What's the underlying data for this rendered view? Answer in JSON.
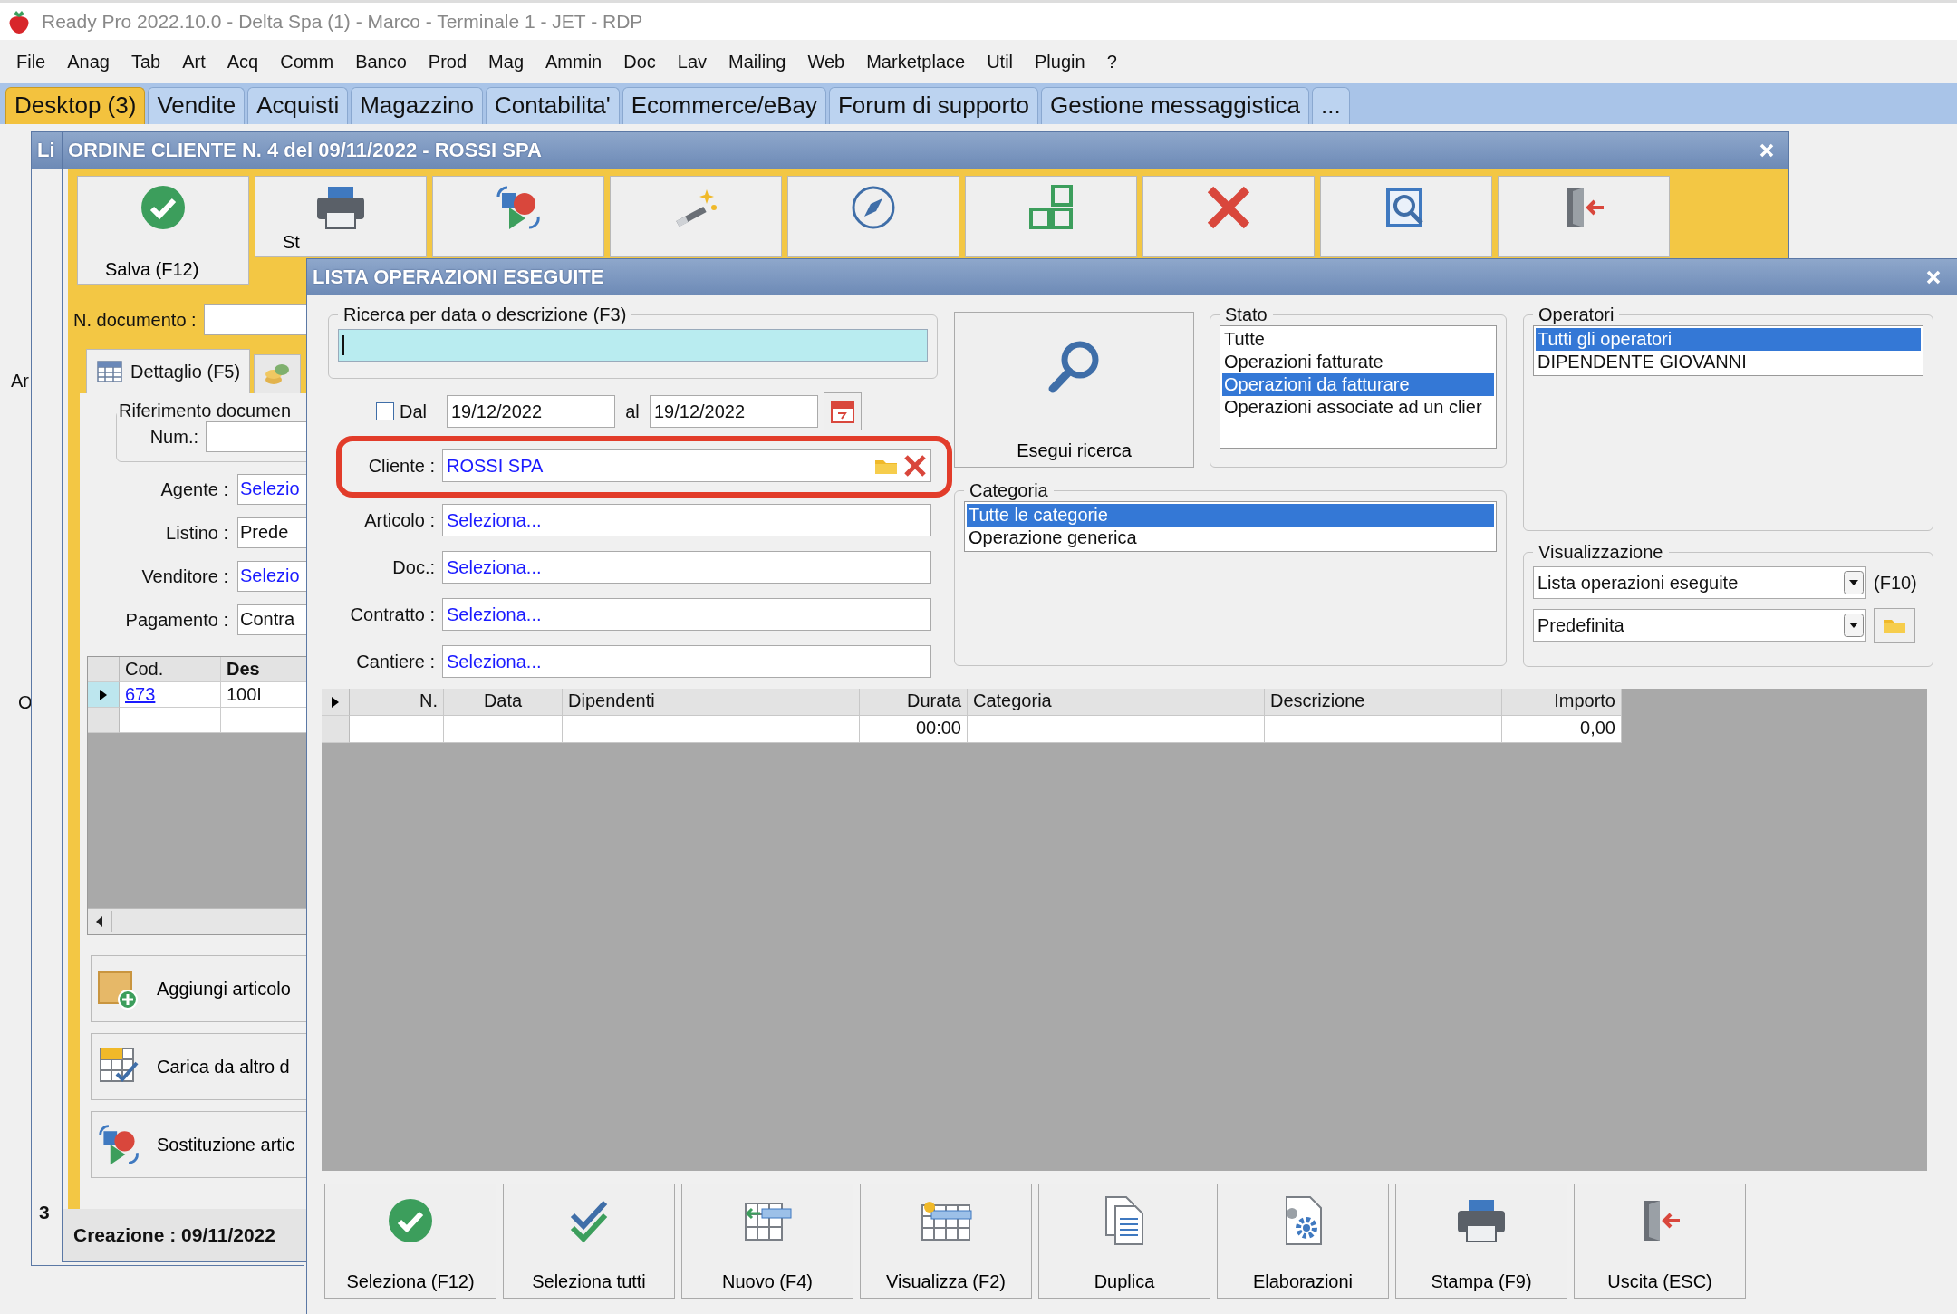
{
  "window": {
    "title": "Ready Pro 2022.10.0 - Delta Spa (1) - Marco - Terminale 1 - JET - RDP"
  },
  "menu": [
    "File",
    "Anag",
    "Tab",
    "Art",
    "Acq",
    "Comm",
    "Banco",
    "Prod",
    "Mag",
    "Ammin",
    "Doc",
    "Lav",
    "Mailing",
    "Web",
    "Marketplace",
    "Util",
    "Plugin",
    "?"
  ],
  "tabs": [
    {
      "label": "Desktop (3)",
      "selected": true
    },
    {
      "label": "Vendite",
      "selected": false
    },
    {
      "label": "Acquisti",
      "selected": false
    },
    {
      "label": "Magazzino",
      "selected": false
    },
    {
      "label": "Contabilita'",
      "selected": false
    },
    {
      "label": "Ecommerce/eBay",
      "selected": false
    },
    {
      "label": "Forum di supporto",
      "selected": false
    },
    {
      "label": "Gestione messaggistica",
      "selected": false
    },
    {
      "label": "...",
      "selected": false
    }
  ],
  "desktop_labels": [
    "Ar",
    "O"
  ],
  "back_window": {
    "title": "Li",
    "footer": "3"
  },
  "order_window": {
    "title": "ORDINE CLIENTE N. 4 del 09/11/2022 - ROSSI SPA",
    "toolbar_labels": [
      "Salva (F12)",
      "St"
    ],
    "document_label": "N. documento :",
    "tabs": [
      {
        "label": "Dettaglio (F5)",
        "selected": true
      },
      {
        "selected": false
      }
    ],
    "reference_group": "Riferimento documen",
    "num_label": "Num.:",
    "fields": [
      {
        "label": "Agente :",
        "value": "Selezio",
        "kind": "link"
      },
      {
        "label": "Listino :",
        "value": "Prede",
        "kind": "text"
      },
      {
        "label": "Venditore :",
        "value": "Selezio",
        "kind": "link"
      },
      {
        "label": "Pagamento :",
        "value": "Contra",
        "kind": "text"
      }
    ],
    "grid": {
      "columns": [
        "Cod.",
        "Des"
      ],
      "rows": [
        {
          "code": "673",
          "description": "100I"
        }
      ]
    },
    "actions": [
      "Aggiungi articolo",
      "Carica da altro d",
      "Sostituzione artic"
    ],
    "status": "Creazione : 09/11/2022"
  },
  "dialog": {
    "title": "LISTA OPERAZIONI ESEGUITE",
    "search": {
      "legend": "Ricerca per data o descrizione (F3)"
    },
    "date_filter": {
      "checked": false,
      "label": "Dal",
      "from": "19/12/2022",
      "to_label": "al",
      "to": "19/12/2022"
    },
    "fields": [
      {
        "label": "Cliente :",
        "value": "ROSSI SPA",
        "kind": "client"
      },
      {
        "label": "Articolo :",
        "value": "Seleziona...",
        "kind": "select"
      },
      {
        "label": "Doc.:",
        "value": "Seleziona...",
        "kind": "select"
      },
      {
        "label": "Contratto :",
        "value": "Seleziona...",
        "kind": "select"
      },
      {
        "label": "Cantiere :",
        "value": "Seleziona...",
        "kind": "select"
      }
    ],
    "search_button": "Esegui ricerca",
    "status": {
      "legend": "Stato",
      "items": [
        {
          "label": "Tutte",
          "selected": false
        },
        {
          "label": "Operazioni fatturate",
          "selected": false
        },
        {
          "label": "Operazioni da fatturare",
          "selected": true
        },
        {
          "label": "Operazioni associate ad un clier",
          "selected": false
        }
      ]
    },
    "operators": {
      "legend": "Operatori",
      "items": [
        {
          "label": "Tutti gli operatori",
          "selected": true
        },
        {
          "label": "DIPENDENTE GIOVANNI",
          "selected": false
        }
      ]
    },
    "category": {
      "legend": "Categoria",
      "items": [
        {
          "label": "Tutte le categorie",
          "selected": true
        },
        {
          "label": "Operazione generica",
          "selected": false
        }
      ]
    },
    "view": {
      "legend": "Visualizzazione",
      "mode": "Lista operazioni eseguite",
      "shortcut": "(F10)",
      "layout": "Predefinita"
    },
    "table": {
      "columns": [
        "N.",
        "Data",
        "Dipendenti",
        "Durata",
        "Categoria",
        "Descrizione",
        "Importo"
      ],
      "rows": [
        {
          "duration": "00:00",
          "amount": "0,00"
        }
      ]
    },
    "buttons": [
      "Seleziona (F12)",
      "Seleziona tutti",
      "Nuovo (F4)",
      "Visualizza (F2)",
      "Duplica",
      "Elaborazioni",
      "Stampa (F9)",
      "Uscita (ESC)"
    ]
  }
}
